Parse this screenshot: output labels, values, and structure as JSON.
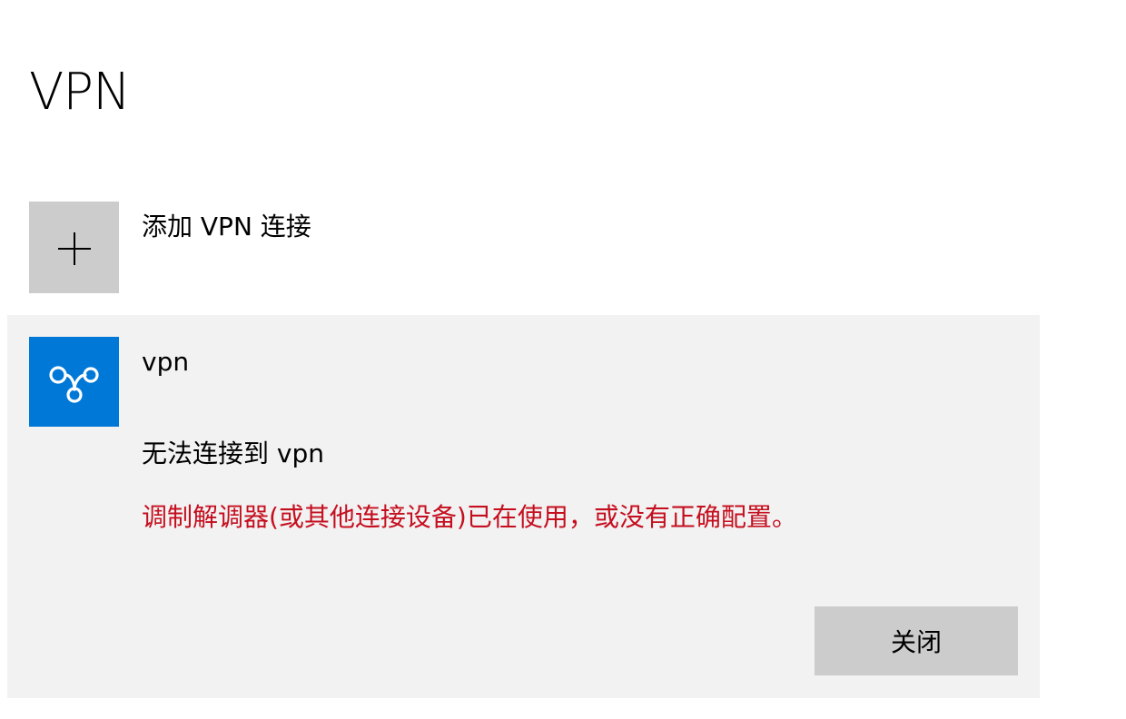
{
  "page": {
    "title": "VPN"
  },
  "add_vpn": {
    "label": "添加 VPN 连接",
    "icon": "plus-icon"
  },
  "connection": {
    "name": "vpn",
    "icon": "vpn-logo-icon",
    "status": "无法连接到 vpn",
    "error": "调制解调器(或其他连接设备)已在使用，或没有正确配置。",
    "close_label": "关闭"
  },
  "colors": {
    "tile_accent": "#0078d7",
    "error": "#c50f1f",
    "card_background": "#f2f2f2",
    "button_background": "#cccccc"
  }
}
